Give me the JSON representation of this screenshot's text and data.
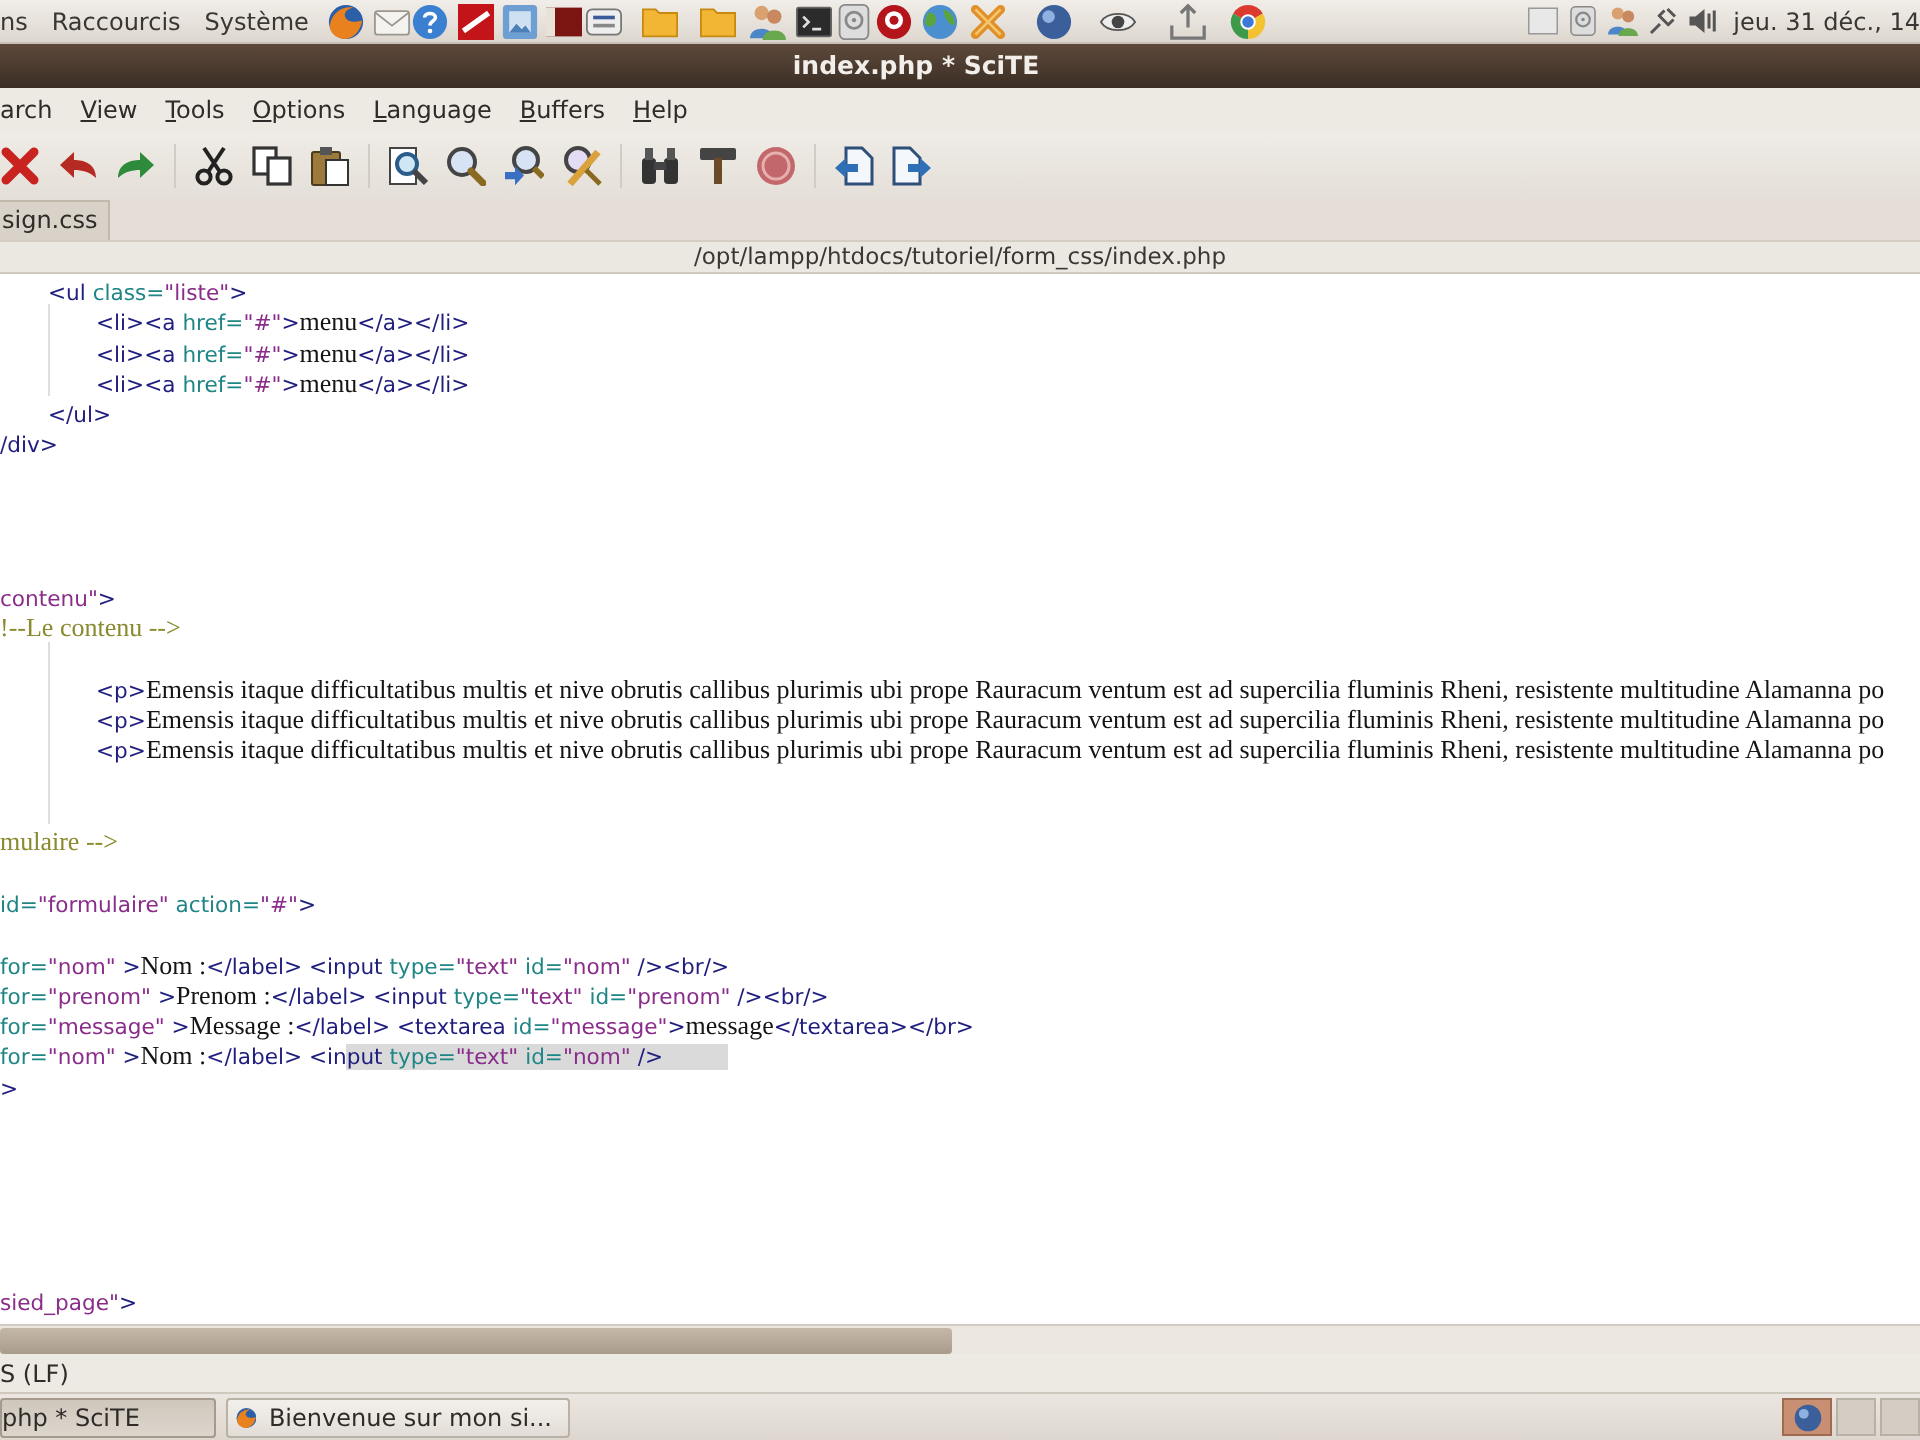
{
  "top_panel": {
    "menus": [
      "ns",
      "Raccourcis",
      "Système"
    ],
    "clock": "jeu. 31 déc., 14"
  },
  "window": {
    "title": "index.php * SciTE"
  },
  "menu_bar": [
    {
      "label": "arch",
      "mnemonic": false
    },
    {
      "label": "View",
      "mnemonic": true
    },
    {
      "label": "Tools",
      "mnemonic": true
    },
    {
      "label": "Options",
      "mnemonic": true
    },
    {
      "label": "Language",
      "mnemonic": true
    },
    {
      "label": "Buffers",
      "mnemonic": true
    },
    {
      "label": "Help",
      "mnemonic": true
    }
  ],
  "tabs": [
    {
      "label": "sign.css",
      "selected": false
    }
  ],
  "path": "/opt/lampp/htdocs/tutoriel/form_css/index.php",
  "editor": {
    "lines": [
      {
        "kind": "group",
        "children": [
          {
            "kind": "code",
            "tokens": [
              {
                "kind": "tag",
                "text": "<ul"
              },
              {
                "kind": "attr",
                "text": " class="
              },
              {
                "kind": "value",
                "text": "\"liste\""
              },
              {
                "kind": "tag",
                "text": ">"
              }
            ],
            "children": [
              {
                "kind": "code",
                "tokens": [
                  {
                    "kind": "tag",
                    "text": "<li><a"
                  },
                  {
                    "kind": "attr",
                    "text": " href="
                  },
                  {
                    "kind": "value",
                    "text": "\"#\""
                  },
                  {
                    "kind": "tag",
                    "text": ">"
                  },
                  {
                    "kind": "text",
                    "text": "menu"
                  },
                  {
                    "kind": "tag",
                    "text": "</a></li>"
                  }
                ]
              },
              {
                "kind": "code",
                "tokens": [
                  {
                    "kind": "tag",
                    "text": "<li><a"
                  },
                  {
                    "kind": "attr",
                    "text": " href="
                  },
                  {
                    "kind": "value",
                    "text": "\"#\""
                  },
                  {
                    "kind": "tag",
                    "text": ">"
                  },
                  {
                    "kind": "text",
                    "text": "menu"
                  },
                  {
                    "kind": "tag",
                    "text": "</a></li>"
                  }
                ]
              },
              {
                "kind": "code",
                "tokens": [
                  {
                    "kind": "tag",
                    "text": "<li><a"
                  },
                  {
                    "kind": "attr",
                    "text": " href="
                  },
                  {
                    "kind": "value",
                    "text": "\"#\""
                  },
                  {
                    "kind": "tag",
                    "text": ">"
                  },
                  {
                    "kind": "text",
                    "text": "menu"
                  },
                  {
                    "kind": "tag",
                    "text": "</a></li>"
                  }
                ]
              }
            ]
          },
          {
            "kind": "code",
            "tokens": [
              {
                "kind": "tag",
                "text": "</ul>"
              }
            ]
          }
        ]
      },
      {
        "kind": "code",
        "tokens": [
          {
            "kind": "tag",
            "text": "/div>"
          }
        ]
      },
      {
        "kind": "blank"
      },
      {
        "kind": "blank"
      },
      {
        "kind": "blank"
      },
      {
        "kind": "blank"
      },
      {
        "kind": "code",
        "tokens": [
          {
            "kind": "value",
            "text": "contenu\""
          },
          {
            "kind": "tag",
            "text": ">"
          }
        ]
      },
      {
        "kind": "code",
        "tokens": [
          {
            "kind": "comment",
            "text": "!--Le contenu -->"
          }
        ]
      },
      {
        "kind": "group",
        "children": [
          {
            "kind": "group",
            "children": [
              {
                "kind": "blank"
              },
              {
                "kind": "code",
                "tokens": [
                  {
                    "kind": "tag",
                    "text": "<p>"
                  },
                  {
                    "kind": "text",
                    "text": "Emensis itaque difficultatibus multis et nive obrutis callibus plurimis ubi prope Rauracum ventum est ad supercilia fluminis Rheni, resistente multitudine Alamanna po"
                  }
                ]
              },
              {
                "kind": "code",
                "tokens": [
                  {
                    "kind": "tag",
                    "text": "<p>"
                  },
                  {
                    "kind": "text",
                    "text": "Emensis itaque difficultatibus multis et nive obrutis callibus plurimis ubi prope Rauracum ventum est ad supercilia fluminis Rheni, resistente multitudine Alamanna po"
                  }
                ]
              },
              {
                "kind": "code",
                "tokens": [
                  {
                    "kind": "tag",
                    "text": "<p>"
                  },
                  {
                    "kind": "text",
                    "text": "Emensis itaque difficultatibus multis et nive obrutis callibus plurimis ubi prope Rauracum ventum est ad supercilia fluminis Rheni, resistente multitudine Alamanna po"
                  }
                ]
              },
              {
                "kind": "blank"
              },
              {
                "kind": "blank"
              }
            ]
          }
        ]
      },
      {
        "kind": "code",
        "tokens": [
          {
            "kind": "comment",
            "text": "mulaire -->"
          }
        ]
      },
      {
        "kind": "blank"
      },
      {
        "kind": "code",
        "tokens": [
          {
            "kind": "attr",
            "text": "id="
          },
          {
            "kind": "value",
            "text": "\"formulaire\""
          },
          {
            "kind": "attr",
            "text": " action="
          },
          {
            "kind": "value",
            "text": "\"#\""
          },
          {
            "kind": "tag",
            "text": ">"
          }
        ]
      },
      {
        "kind": "blank"
      },
      {
        "kind": "code",
        "tokens": [
          {
            "kind": "attr",
            "text": "for="
          },
          {
            "kind": "value",
            "text": "\"nom\""
          },
          {
            "kind": "tag",
            "text": " >"
          },
          {
            "kind": "text",
            "text": "Nom :"
          },
          {
            "kind": "tag",
            "text": "</label> <input"
          },
          {
            "kind": "attr",
            "text": " type="
          },
          {
            "kind": "value",
            "text": "\"text\""
          },
          {
            "kind": "attr",
            "text": " id="
          },
          {
            "kind": "value",
            "text": "\"nom\""
          },
          {
            "kind": "tag",
            "text": " /><br/>"
          }
        ]
      },
      {
        "kind": "code",
        "tokens": [
          {
            "kind": "attr",
            "text": "for="
          },
          {
            "kind": "value",
            "text": "\"prenom\""
          },
          {
            "kind": "tag",
            "text": " >"
          },
          {
            "kind": "text",
            "text": "Prenom :"
          },
          {
            "kind": "tag",
            "text": "</label> <input"
          },
          {
            "kind": "attr",
            "text": " type="
          },
          {
            "kind": "value",
            "text": "\"text\""
          },
          {
            "kind": "attr",
            "text": " id="
          },
          {
            "kind": "value",
            "text": "\"prenom\""
          },
          {
            "kind": "tag",
            "text": " /><br/>"
          }
        ]
      },
      {
        "kind": "code",
        "tokens": [
          {
            "kind": "attr",
            "text": "for="
          },
          {
            "kind": "value",
            "text": "\"message\""
          },
          {
            "kind": "tag",
            "text": " >"
          },
          {
            "kind": "text",
            "text": "Message :"
          },
          {
            "kind": "tag",
            "text": "</label> <textarea"
          },
          {
            "kind": "attr",
            "text": " id="
          },
          {
            "kind": "value",
            "text": "\"message\""
          },
          {
            "kind": "tag",
            "text": ">"
          },
          {
            "kind": "text",
            "text": "message"
          },
          {
            "kind": "tag",
            "text": "</textarea></br>"
          }
        ]
      },
      {
        "kind": "code",
        "tokens": [
          {
            "kind": "attr",
            "text": "for="
          },
          {
            "kind": "value",
            "text": "\"nom\""
          },
          {
            "kind": "tag",
            "text": " >"
          },
          {
            "kind": "text",
            "text": "Nom :"
          },
          {
            "kind": "tag",
            "text": "</label> <in"
          }
        ],
        "selection": [
          {
            "kind": "tag",
            "text": "put"
          },
          {
            "kind": "attr",
            "text": " type="
          },
          {
            "kind": "value",
            "text": "\"text\""
          },
          {
            "kind": "attr",
            "text": " id="
          },
          {
            "kind": "value",
            "text": "\"nom\""
          },
          {
            "kind": "tag",
            "text": " />"
          }
        ]
      },
      {
        "kind": "code",
        "tokens": [
          {
            "kind": "tag",
            "text": ">"
          }
        ]
      },
      {
        "kind": "blank"
      },
      {
        "kind": "blank"
      },
      {
        "kind": "blank"
      },
      {
        "kind": "blank"
      },
      {
        "kind": "blank"
      },
      {
        "kind": "blank"
      },
      {
        "kind": "code",
        "tokens": [
          {
            "kind": "value",
            "text": "sied_page\""
          },
          {
            "kind": "tag",
            "text": ">"
          }
        ]
      }
    ]
  },
  "status_bar": "S (LF)",
  "taskbar": [
    {
      "label": "php * SciTE",
      "kind": "editor",
      "selected": true
    },
    {
      "label": "Bienvenue sur mon si...",
      "kind": "browser",
      "selected": false
    }
  ]
}
